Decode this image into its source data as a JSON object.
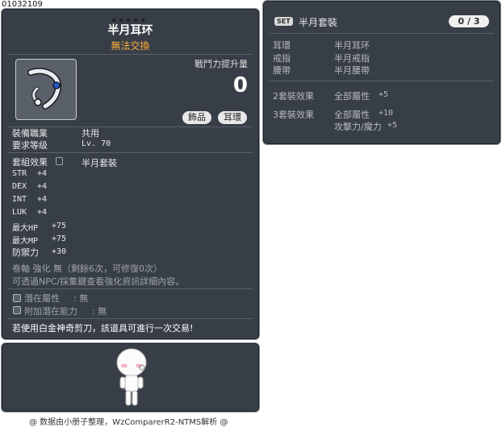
{
  "item_id": "01032109",
  "stars": "★★★★★",
  "item": {
    "name": "半月耳环",
    "trade_status": "無法交換",
    "power_label": "戰鬥力提升量",
    "power_value": "0",
    "tags": [
      "飾品",
      "耳環"
    ]
  },
  "requirements": {
    "job_label": "裝備職業",
    "job_value": "共用",
    "level_label": "要求等级",
    "level_value": "Lv. 70"
  },
  "set_effect": {
    "label": "套組效果",
    "value": "半月套裝"
  },
  "stats": [
    {
      "name": "STR",
      "value": "+4"
    },
    {
      "name": "DEX",
      "value": "+4"
    },
    {
      "name": "INT",
      "value": "+4"
    },
    {
      "name": "LUK",
      "value": "+4"
    },
    {
      "name": "最大HP",
      "value": "+75"
    },
    {
      "name": "最大MP",
      "value": "+75"
    },
    {
      "name": "防禦力",
      "value": "+30"
    }
  ],
  "scroll": {
    "line1": "卷軸 強化 無（剩餘6次，可修復0次）",
    "line2": "可透過NPC/採集鍵查看強化資訊詳細內容。"
  },
  "potential": {
    "label": "潛在屬性",
    "value": ": 無",
    "additional_label": "附加潛在能力",
    "additional_value": ": 無"
  },
  "scissors_notice": "若使用白金神奇剪刀，該道具可進行一次交易!",
  "set_panel": {
    "badge": "SET",
    "name": "半月套裝",
    "count": "0 / 3",
    "parts": [
      {
        "slot": "耳環",
        "name": "半月耳环"
      },
      {
        "slot": "戒指",
        "name": "半月戒指"
      },
      {
        "slot": "腰帶",
        "name": "半月腰帶"
      }
    ],
    "bonuses": [
      {
        "label": "2套裝效果",
        "lines": [
          {
            "stat": "全部屬性",
            "value": "+5"
          }
        ]
      },
      {
        "label": "3套裝效果",
        "lines": [
          {
            "stat": "全部屬性",
            "value": "+10"
          },
          {
            "stat": "攻擊力/魔力",
            "value": "+5"
          }
        ]
      }
    ]
  },
  "footer": "@ 数据由小册子整理，WzComparerR2-NTMS解析 @"
}
